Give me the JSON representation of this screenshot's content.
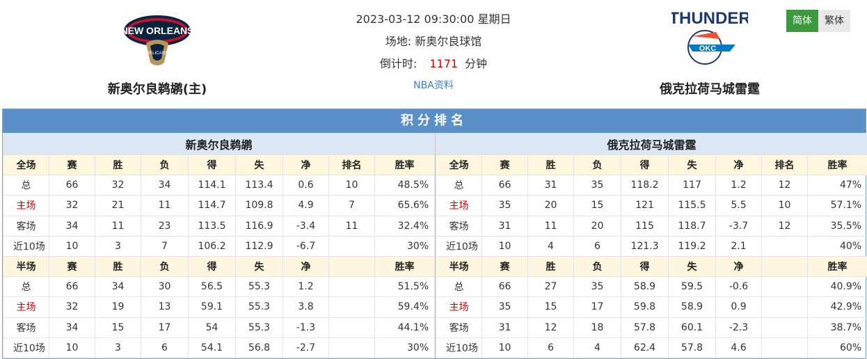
{
  "match": {
    "datetime": "2023-03-12 09:30:00 星期日",
    "venue": "场地: 新奥尔良球馆",
    "countdown_label": "倒计时:",
    "countdown_value": "1171",
    "countdown_unit": "分钟",
    "nba_link": "NBA资料"
  },
  "home": {
    "name": "新奥尔良鹈鹕(主)",
    "logo_text": "NEW ORLEANS",
    "logo_sub": "PELICANS"
  },
  "away": {
    "name": "俄克拉荷马城雷霆",
    "logo_text": "THUNDER",
    "logo_sub": "OKC"
  },
  "lang": {
    "simplified": "简体",
    "traditional": "繁体"
  },
  "standings": {
    "title": "积分排名",
    "full_headers": [
      "全场",
      "赛",
      "胜",
      "负",
      "得",
      "失",
      "净",
      "排名",
      "胜率"
    ],
    "half_headers": [
      "半场",
      "赛",
      "胜",
      "负",
      "得",
      "失",
      "净",
      "",
      "胜率"
    ],
    "left": {
      "team": "新奥尔良鹈鹕",
      "full": [
        [
          "总",
          "66",
          "32",
          "34",
          "114.1",
          "113.4",
          "0.6",
          "10",
          "48.5%"
        ],
        [
          "主场",
          "32",
          "21",
          "11",
          "114.7",
          "109.8",
          "4.9",
          "7",
          "65.6%"
        ],
        [
          "客场",
          "34",
          "11",
          "23",
          "113.5",
          "116.9",
          "-3.4",
          "11",
          "32.4%"
        ],
        [
          "近10场",
          "10",
          "3",
          "7",
          "106.2",
          "112.9",
          "-6.7",
          "",
          "30%"
        ]
      ],
      "half": [
        [
          "总",
          "66",
          "34",
          "30",
          "56.5",
          "55.3",
          "1.2",
          "",
          "51.5%"
        ],
        [
          "主场",
          "32",
          "19",
          "13",
          "59.1",
          "55.3",
          "3.8",
          "",
          "59.4%"
        ],
        [
          "客场",
          "34",
          "15",
          "17",
          "54",
          "55.3",
          "-1.3",
          "",
          "44.1%"
        ],
        [
          "近10场",
          "10",
          "3",
          "6",
          "54.1",
          "56.8",
          "-2.7",
          "",
          "30%"
        ]
      ]
    },
    "right": {
      "team": "俄克拉荷马城雷霆",
      "full": [
        [
          "总",
          "66",
          "31",
          "35",
          "118.2",
          "117",
          "1.2",
          "12",
          "47%"
        ],
        [
          "主场",
          "35",
          "20",
          "15",
          "121",
          "115.5",
          "5.5",
          "10",
          "57.1%"
        ],
        [
          "客场",
          "31",
          "11",
          "20",
          "115",
          "118.7",
          "-3.7",
          "12",
          "35.5%"
        ],
        [
          "近10场",
          "10",
          "4",
          "6",
          "121.3",
          "119.2",
          "2.1",
          "",
          "40%"
        ]
      ],
      "half": [
        [
          "总",
          "66",
          "27",
          "35",
          "58.9",
          "59.5",
          "-0.6",
          "",
          "40.9%"
        ],
        [
          "主场",
          "35",
          "15",
          "17",
          "59.8",
          "58.9",
          "0.9",
          "",
          "42.9%"
        ],
        [
          "客场",
          "31",
          "12",
          "18",
          "57.8",
          "60.1",
          "-2.3",
          "",
          "38.7%"
        ],
        [
          "近10场",
          "10",
          "6",
          "4",
          "62.4",
          "57.8",
          "4.6",
          "",
          "60%"
        ]
      ]
    }
  },
  "colors": {
    "accent_blue": "#5b8fc7",
    "header_yellow": "#fef6dd",
    "red": "#e00000",
    "green": "#3c9a3c"
  }
}
